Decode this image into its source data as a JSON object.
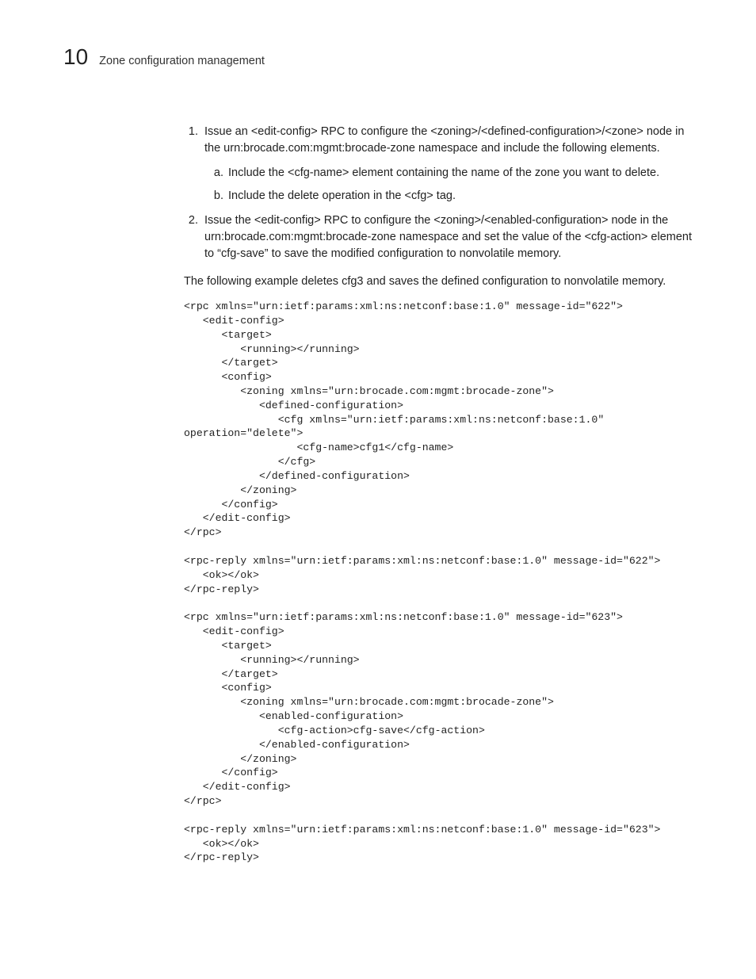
{
  "page_number": "10",
  "header_title": "Zone configuration management",
  "steps": {
    "s1": "Issue an <edit-config> RPC to configure the <zoning>/<defined-configuration>/<zone> node in the urn:brocade.com:mgmt:brocade-zone namespace and include the following elements.",
    "s1a": "Include the <cfg-name> element containing the name of the zone you want to delete.",
    "s1b": "Include the delete operation in the <cfg> tag.",
    "s2": "Issue the <edit-config> RPC to configure the <zoning>/<enabled-configuration> node in the urn:brocade.com:mgmt:brocade-zone namespace and set the value of the <cfg-action> element to “cfg-save” to save the modified configuration to nonvolatile memory."
  },
  "intro_para": "The following example deletes cfg3 and saves the defined configuration to nonvolatile memory.",
  "code1": "<rpc xmlns=\"urn:ietf:params:xml:ns:netconf:base:1.0\" message-id=\"622\">\n   <edit-config>\n      <target>\n         <running></running>\n      </target>\n      <config>\n         <zoning xmlns=\"urn:brocade.com:mgmt:brocade-zone\">\n            <defined-configuration>\n               <cfg xmlns=\"urn:ietf:params:xml:ns:netconf:base:1.0\" operation=\"delete\">\n                  <cfg-name>cfg1</cfg-name>\n               </cfg>\n            </defined-configuration>\n         </zoning>\n      </config>\n   </edit-config>\n</rpc>\n",
  "code2": "<rpc-reply xmlns=\"urn:ietf:params:xml:ns:netconf:base:1.0\" message-id=\"622\">\n   <ok></ok>\n</rpc-reply>\n",
  "code3": "<rpc xmlns=\"urn:ietf:params:xml:ns:netconf:base:1.0\" message-id=\"623\">\n   <edit-config>\n      <target>\n         <running></running>\n      </target>\n      <config>\n         <zoning xmlns=\"urn:brocade.com:mgmt:brocade-zone\">\n            <enabled-configuration>\n               <cfg-action>cfg-save</cfg-action>\n            </enabled-configuration>\n         </zoning>\n      </config>\n   </edit-config>\n</rpc>",
  "code4": "<rpc-reply xmlns=\"urn:ietf:params:xml:ns:netconf:base:1.0\" message-id=\"623\">\n   <ok></ok>\n</rpc-reply>"
}
